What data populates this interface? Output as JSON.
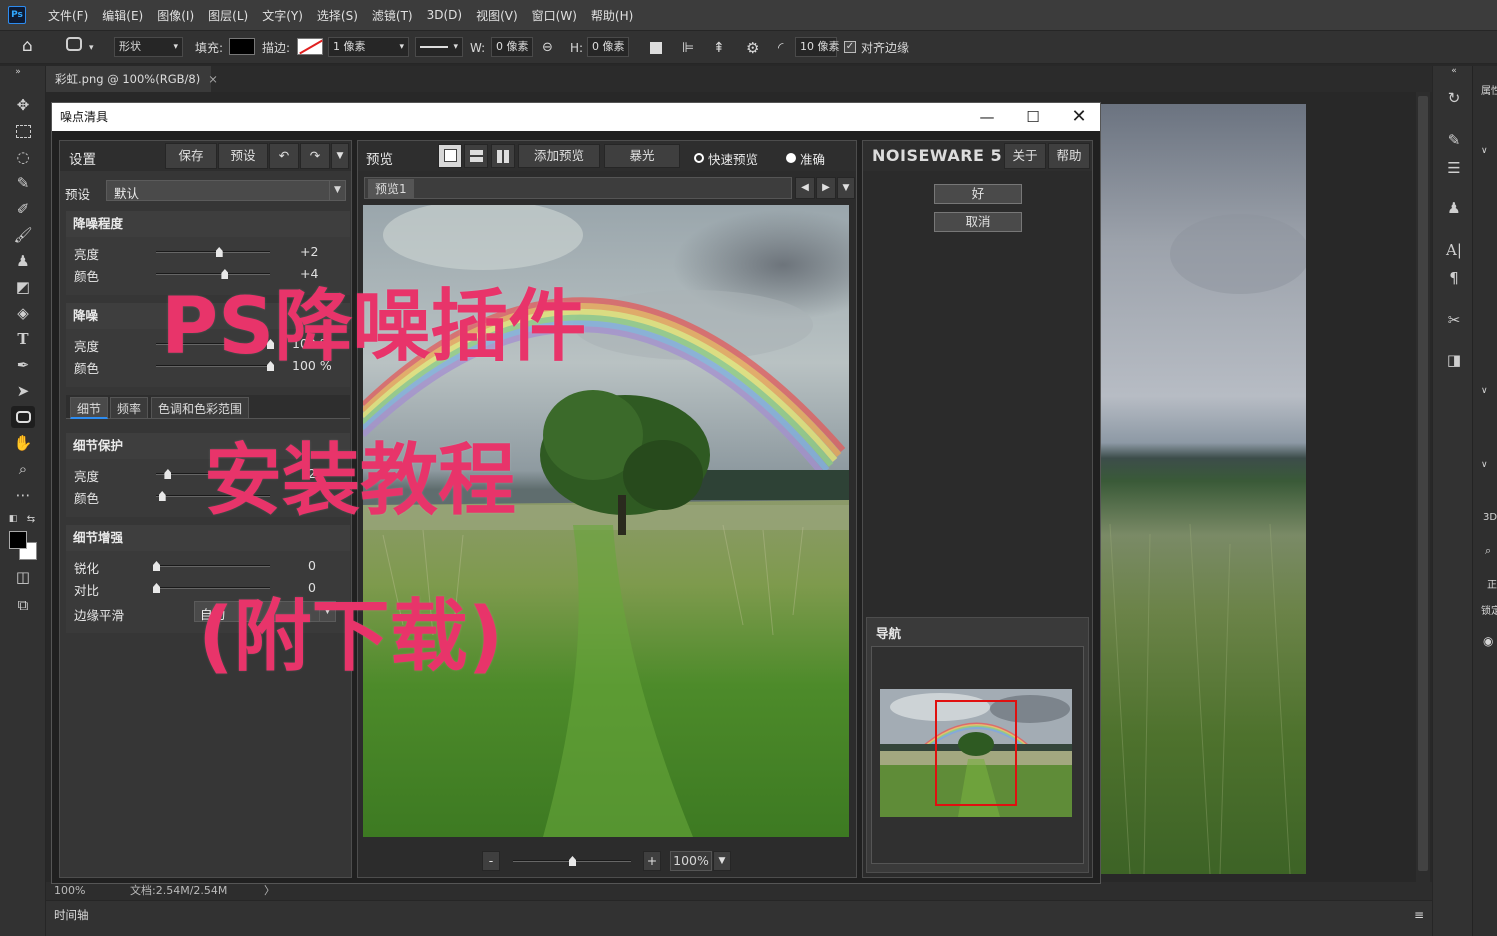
{
  "menu": [
    "文件(F)",
    "编辑(E)",
    "图像(I)",
    "图层(L)",
    "文字(Y)",
    "选择(S)",
    "滤镜(T)",
    "3D(D)",
    "视图(V)",
    "窗口(W)",
    "帮助(H)"
  ],
  "app_logo": "Ps",
  "options": {
    "shape_mode": "形状",
    "fill_label": "填充:",
    "stroke_label": "描边:",
    "stroke_width": "1 像素",
    "w_label": "W:",
    "w_value": "0 像素",
    "h_label": "H:",
    "h_value": "0 像素",
    "radius": "10 像素",
    "align_edges": "对齐边缘"
  },
  "doc_tab": "彩虹.png @ 100%(RGB/8)",
  "doc_tab_close": "×",
  "status": {
    "zoom": "100%",
    "doc": "文档:2.54M/2.54M",
    "arrow": "〉"
  },
  "timeline": "时间轴",
  "right_panel": {
    "props": "属性",
    "threed": "3D",
    "lock": "锁定",
    "hint": "正"
  },
  "dialog": {
    "title": "噪点清具",
    "settings": {
      "header": "设置",
      "save": "保存",
      "preset_btn": "预设",
      "preset_label": "预设",
      "preset_value": "默认",
      "noise_level": {
        "title": "降噪程度",
        "rows": [
          {
            "label": "亮度",
            "value": "+2",
            "pos": 0.55
          },
          {
            "label": "颜色",
            "value": "+4",
            "pos": 0.6
          }
        ]
      },
      "noise_reduction": {
        "title": "降噪",
        "rows": [
          {
            "label": "亮度",
            "value": "100 %",
            "pos": 1.0
          },
          {
            "label": "颜色",
            "value": "100 %",
            "pos": 1.0
          }
        ]
      },
      "tabs": [
        "细节",
        "频率",
        "色调和色彩范围"
      ],
      "detail_protect": {
        "title": "细节保护",
        "rows": [
          {
            "label": "亮度",
            "value": "2",
            "pos": 0.1
          },
          {
            "label": "颜色",
            "value": "",
            "pos": 0.05
          }
        ]
      },
      "detail_enhance": {
        "title": "细节增强",
        "rows": [
          {
            "label": "锐化",
            "value": "0",
            "pos": 0.0
          },
          {
            "label": "对比",
            "value": "0",
            "pos": 0.0
          }
        ],
        "edge_label": "边缘平滑",
        "edge_value": "自动"
      }
    },
    "preview": {
      "header": "预览",
      "add_preview": "添加预览",
      "exposure": "暴光",
      "quick": "快速预览",
      "accurate": "准确",
      "tab": "预览1",
      "zoom": "100%",
      "minus": "-",
      "plus": "+"
    },
    "brand": {
      "name": "NOISEWARE 5",
      "about": "关于",
      "help": "帮助",
      "ok": "好",
      "cancel": "取消",
      "nav_title": "导航"
    }
  },
  "overlay": {
    "line1": "PS降噪插件",
    "line2": "安装教程",
    "line3": "(附下载)"
  },
  "colors": {
    "overlay": "#e8346a",
    "nav_rect": "#e01010"
  }
}
